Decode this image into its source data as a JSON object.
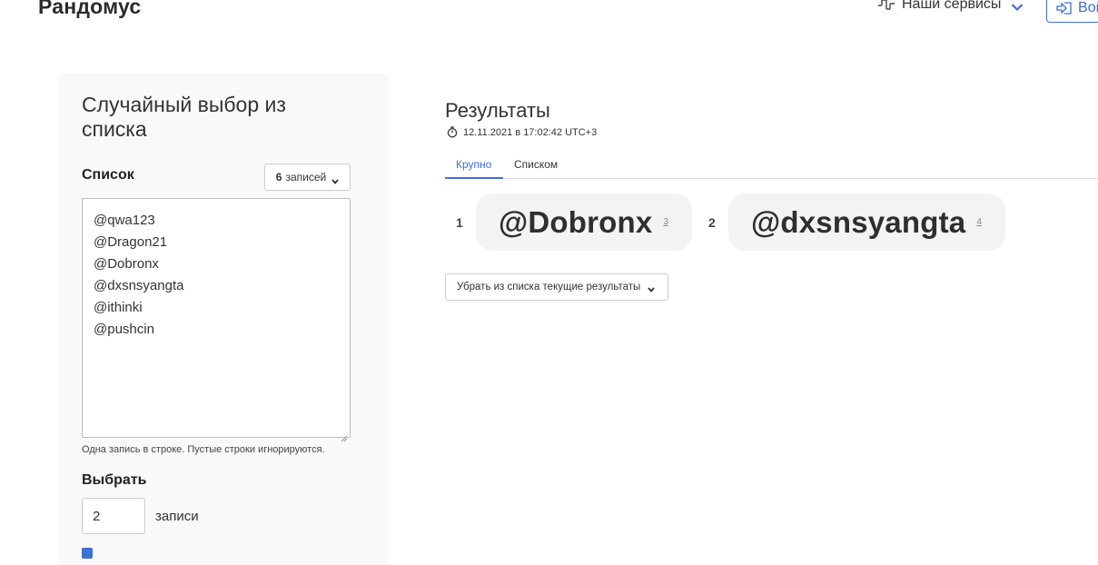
{
  "header": {
    "brand": "Рандомус",
    "services_label": "Наши сервисы",
    "login_label": "Войти"
  },
  "card": {
    "title": "Случайный выбор из списка",
    "list_label": "Список",
    "count_value": "6",
    "count_unit": "записей",
    "list_lines": [
      "@qwa123",
      "@Dragon21",
      "@Dobronx",
      "@dxsnsyangta",
      "@ithinki",
      "@pushcin"
    ],
    "hint": "Одна запись в строке. Пустые строки игнорируются.",
    "pick_label": "Выбрать",
    "pick_value": "2",
    "pick_unit": "записи"
  },
  "results": {
    "title": "Результаты",
    "timestamp": "12.11.2021 в 17:02:42 UTC+3",
    "tabs": [
      {
        "label": "Крупно",
        "active": true
      },
      {
        "label": "Списком",
        "active": false
      }
    ],
    "items": [
      {
        "rank": "1",
        "name": "@Dobronx",
        "index": "3"
      },
      {
        "rank": "2",
        "name": "@dxsnsyangta",
        "index": "4"
      }
    ],
    "remove_label": "Убрать из списка текущие результаты"
  },
  "colors": {
    "accent": "#3f6fd1",
    "pill_bg": "#f3f3f3",
    "card_bg": "#f9f9f9"
  },
  "icons": {
    "services": "services-icon",
    "login": "login-icon",
    "clock": "stopwatch-icon",
    "chevron": "chevron-down-icon"
  }
}
